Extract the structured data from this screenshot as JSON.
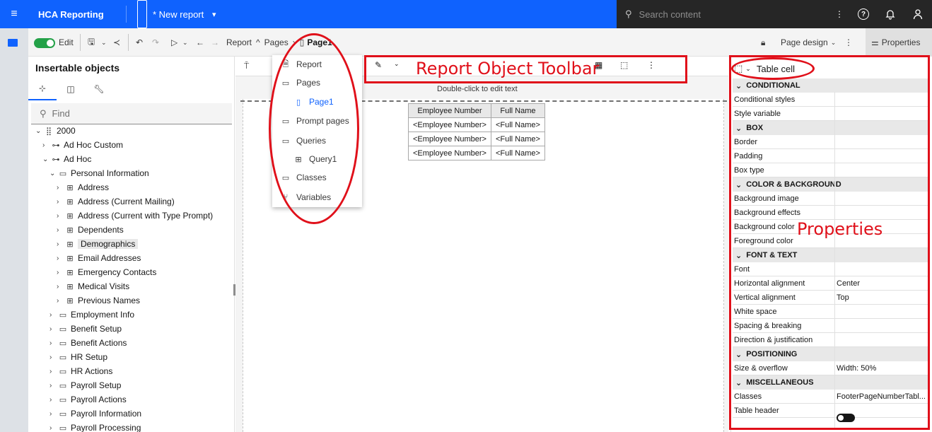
{
  "topbar": {
    "brand": "HCA Reporting",
    "report_name": "* New report",
    "search_placeholder": "Search content"
  },
  "toolbar": {
    "edit_label": "Edit",
    "breadcrumb_report": "Report",
    "breadcrumb_pages": "Pages",
    "breadcrumb_page": "Page1",
    "page_design_label": "Page design",
    "properties_label": "Properties"
  },
  "left_panel": {
    "title": "Insertable objects",
    "find_placeholder": "Find",
    "tree": [
      {
        "label": "2000",
        "chev": "⌄"
      },
      {
        "label": "Ad Hoc Custom",
        "chev": "›"
      },
      {
        "label": "Ad Hoc",
        "chev": "⌄"
      },
      {
        "label": "Personal Information",
        "chev": "⌄"
      },
      {
        "label": "Address",
        "chev": "›"
      },
      {
        "label": "Address (Current Mailing)",
        "chev": "›"
      },
      {
        "label": "Address (Current with Type Prompt)",
        "chev": "›"
      },
      {
        "label": "Dependents",
        "chev": "›"
      },
      {
        "label": "Demographics",
        "chev": "›"
      },
      {
        "label": "Email Addresses",
        "chev": "›"
      },
      {
        "label": "Emergency Contacts",
        "chev": "›"
      },
      {
        "label": "Medical Visits",
        "chev": "›"
      },
      {
        "label": "Previous Names",
        "chev": "›"
      },
      {
        "label": "Employment Info",
        "chev": "›"
      },
      {
        "label": "Benefit Setup",
        "chev": "›"
      },
      {
        "label": "Benefit Actions",
        "chev": "›"
      },
      {
        "label": "HR Setup",
        "chev": "›"
      },
      {
        "label": "HR Actions",
        "chev": "›"
      },
      {
        "label": "Payroll Setup",
        "chev": "›"
      },
      {
        "label": "Payroll Actions",
        "chev": "›"
      },
      {
        "label": "Payroll Information",
        "chev": "›"
      },
      {
        "label": "Payroll Processing",
        "chev": "›"
      }
    ]
  },
  "popup_menu": {
    "items": [
      "Report",
      "Pages",
      "Page1",
      "Prompt pages",
      "Queries",
      "Query1",
      "Classes",
      "Variables"
    ]
  },
  "canvas": {
    "hint": "Double-click to edit text",
    "table": {
      "headers": [
        "Employee Number",
        "Full Name"
      ],
      "rows": [
        [
          "<Employee Number>",
          "<Full Name>"
        ],
        [
          "<Employee Number>",
          "<Full Name>"
        ],
        [
          "<Employee Number>",
          "<Full Name>"
        ]
      ]
    }
  },
  "properties": {
    "object_label": "Table cell",
    "sections": [
      {
        "title": "CONDITIONAL",
        "rows": [
          [
            "Conditional styles",
            ""
          ],
          [
            "Style variable",
            ""
          ]
        ]
      },
      {
        "title": "BOX",
        "rows": [
          [
            "Border",
            ""
          ],
          [
            "Padding",
            ""
          ],
          [
            "Box type",
            ""
          ]
        ]
      },
      {
        "title": "COLOR & BACKGROUND",
        "rows": [
          [
            "Background image",
            ""
          ],
          [
            "Background effects",
            ""
          ],
          [
            "Background color",
            ""
          ],
          [
            "Foreground color",
            ""
          ]
        ]
      },
      {
        "title": "FONT & TEXT",
        "rows": [
          [
            "Font",
            ""
          ],
          [
            "Horizontal alignment",
            "Center"
          ],
          [
            "Vertical alignment",
            "Top"
          ],
          [
            "White space",
            ""
          ],
          [
            "Spacing & breaking",
            ""
          ],
          [
            "Direction & justification",
            ""
          ]
        ]
      },
      {
        "title": "POSITIONING",
        "rows": [
          [
            "Size & overflow",
            "Width: 50%"
          ]
        ]
      },
      {
        "title": "MISCELLANEOUS",
        "rows": [
          [
            "Classes",
            "FooterPageNumberTabl..."
          ],
          [
            "Table header",
            ""
          ]
        ]
      }
    ],
    "table_header_on": false
  },
  "annotations": {
    "toolbar_label": "Report Object Toolbar",
    "properties_label": "Properties"
  }
}
